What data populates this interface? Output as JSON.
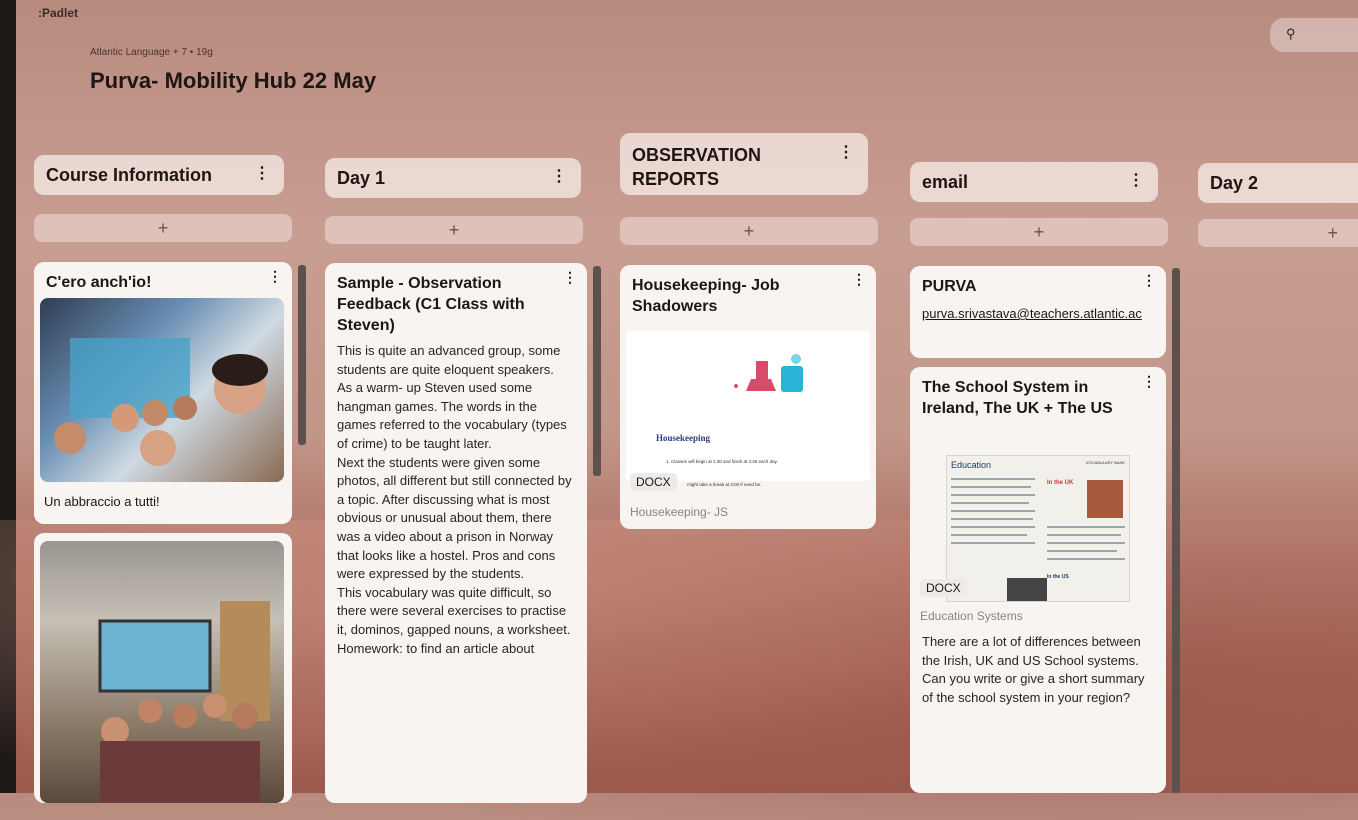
{
  "app": {
    "brand": ":Padlet"
  },
  "header": {
    "meta": "Atlantic Language + 7 • 19g",
    "title": "Purva- Mobility Hub 22 May"
  },
  "search": {
    "icon": "search-icon"
  },
  "columns": [
    {
      "title": "Course Information",
      "add": "+"
    },
    {
      "title": "Day 1",
      "add": "+"
    },
    {
      "title": "OBSERVATION REPORTS",
      "add": "+"
    },
    {
      "title": "email",
      "add": "+"
    },
    {
      "title": "Day 2",
      "add": "+"
    }
  ],
  "cards": {
    "course1": {
      "title": "C'ero anch'io!",
      "caption": "Un abbraccio a tutti!"
    },
    "day1": {
      "title": "Sample - Observation Feedback (C1 Class with Steven)",
      "body": " This is quite an advanced group, some students  are quite eloquent speakers.\nAs a warm- up Steven used some hangman games. The words in the games referred to the vocabulary (types of crime) to be taught later.\nNext the students were given some photos, all different but still connected by a topic. After discussing what is most obvious or unusual about them, there was a video about a prison in Norway that looks like a hostel. Pros and cons were expressed by the students.\nThis vocabulary was quite difficult, so there were several exercises to practise it, dominos, gapped nouns, a worksheet.\nHomework: to find an article about"
    },
    "obs": {
      "title": "Housekeeping- Job Shadowers",
      "doc_heading": "Housekeeping",
      "doc_line1": "1. Classes will begin at 1:30 and finish at 4:45 each day.",
      "doc_line2": "might take a break at 3:00 if need be.",
      "badge": "DOCX",
      "file": "Housekeeping- JS"
    },
    "email1": {
      "title": "PURVA",
      "link": "purva.srivastava@teachers.atlantic.ac"
    },
    "email2": {
      "title": "The School System in Ireland, The UK + The US",
      "doc_heading": "Education",
      "doc_tag": "VOCABULARY BANK",
      "doc_sub1": "In the UK",
      "doc_sub2": "In the US",
      "badge": "DOCX",
      "file": "Education Systems",
      "body": "There are a lot of differences between the Irish, UK and US School systems.\nCan you write or give a short summary of the school system in your region?"
    }
  }
}
